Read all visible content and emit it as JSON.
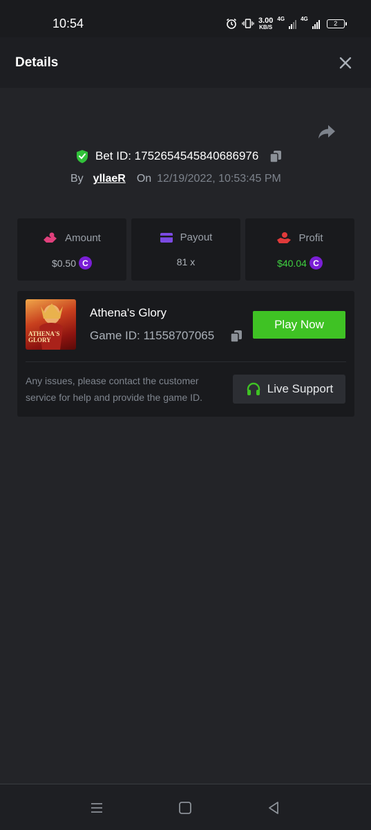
{
  "status_bar": {
    "time": "10:54",
    "net_speed_value": "3.00",
    "net_speed_unit": "KB/S",
    "network_1": "4G",
    "network_2": "4G",
    "battery": "2"
  },
  "header": {
    "title": "Details"
  },
  "bet": {
    "id_label": "Bet ID: 1752654545840686976",
    "by_label": "By",
    "user": "yllaeR",
    "on_label": "On",
    "date": "12/19/2022, 10:53:45 PM"
  },
  "stats": [
    {
      "label": "Amount",
      "value": "$0.50",
      "icon": "hand-coins-icon",
      "color": "#e0407c"
    },
    {
      "label": "Payout",
      "value": "81 x",
      "icon": "card-icon",
      "color": "#7b4ae2"
    },
    {
      "label": "Profit",
      "value": "$40.04",
      "icon": "money-hand-icon",
      "color": "#e03a3a"
    }
  ],
  "coin_symbol": "C",
  "game": {
    "name": "Athena's Glory",
    "id_label": "Game ID: 11558707065",
    "thumb_line1": "ATHENA'S",
    "thumb_line2": "GLORY",
    "play_label": "Play Now",
    "help_text": "Any issues, please contact the customer service for help and provide the game ID.",
    "support_label": "Live Support"
  },
  "colors": {
    "accent_green": "#3fc224",
    "profit_green": "#3fd040",
    "coin_purple": "#7a1fd6"
  }
}
